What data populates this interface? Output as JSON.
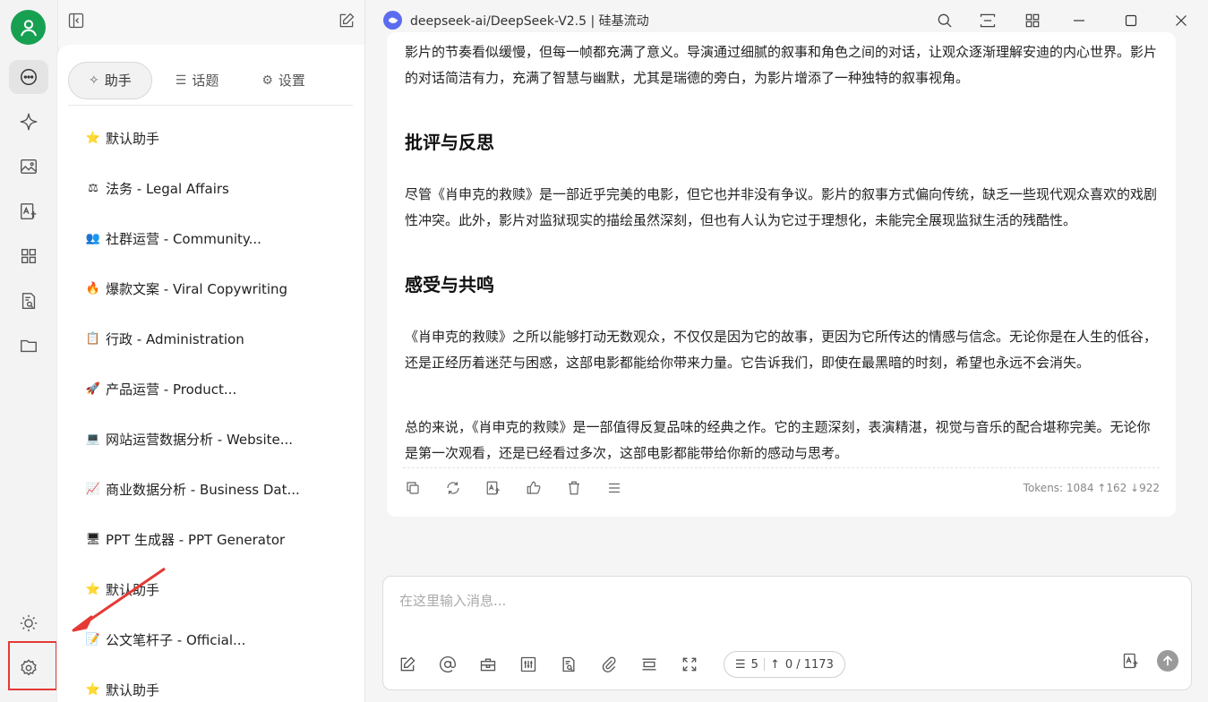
{
  "window": {
    "title": "deepseek-ai/DeepSeek-V2.5 | 硅基流动"
  },
  "sidebar": {
    "tabs": [
      {
        "label": "助手",
        "icon": "sparkle-icon"
      },
      {
        "label": "话题",
        "icon": "list-icon"
      },
      {
        "label": "设置",
        "icon": "gear-icon"
      }
    ],
    "assistants": [
      {
        "emoji": "⭐",
        "label": "默认助手"
      },
      {
        "emoji": "⚖",
        "label": "法务 - Legal Affairs"
      },
      {
        "emoji": "👥",
        "label": "社群运营 - Community..."
      },
      {
        "emoji": "🔥",
        "label": "爆款文案 - Viral Copywriting"
      },
      {
        "emoji": "📋",
        "label": "行政 - Administration"
      },
      {
        "emoji": "🚀",
        "label": "产品运营 - Product..."
      },
      {
        "emoji": "💻",
        "label": "网站运营数据分析 - Website..."
      },
      {
        "emoji": "📈",
        "label": "商业数据分析 - Business Dat..."
      },
      {
        "emoji": "🖥",
        "label": "PPT 生成器 - PPT Generator"
      },
      {
        "emoji": "⭐",
        "label": "默认助手"
      },
      {
        "emoji": "📝",
        "label": "公文笔杆子 - Official..."
      },
      {
        "emoji": "⭐",
        "label": "默认助手"
      }
    ]
  },
  "message": {
    "p1": "影片的节奏看似缓慢，但每一帧都充满了意义。导演通过细腻的叙事和角色之间的对话，让观众逐渐理解安迪的内心世界。影片的对话简洁有力，充满了智慧与幽默，尤其是瑞德的旁白，为影片增添了一种独特的叙事视角。",
    "h1": "批评与反思",
    "p2": "尽管《肖申克的救赎》是一部近乎完美的电影，但它也并非没有争议。影片的叙事方式偏向传统，缺乏一些现代观众喜欢的戏剧性冲突。此外，影片对监狱现实的描绘虽然深刻，但也有人认为它过于理想化，未能完全展现监狱生活的残酷性。",
    "h2": "感受与共鸣",
    "p3": "《肖申克的救赎》之所以能够打动无数观众，不仅仅是因为它的故事，更因为它所传达的情感与信念。无论你是在人生的低谷，还是正经历着迷茫与困惑，这部电影都能给你带来力量。它告诉我们，即使在最黑暗的时刻，希望也永远不会消失。",
    "p4": "总的来说，《肖申克的救赎》是一部值得反复品味的经典之作。它的主题深刻，表演精湛，视觉与音乐的配合堪称完美。无论你是第一次观看，还是已经看过多次，这部电影都能带给你新的感动与思考。",
    "tokens": "Tokens: 1084 ↑162 ↓922"
  },
  "input": {
    "placeholder": "在这里输入消息...",
    "context_count": "5",
    "token_count": "0 / 1173"
  },
  "colors": {
    "avatar": "#17a052",
    "highlight": "#e53935",
    "logo": "#5b6cf0"
  }
}
